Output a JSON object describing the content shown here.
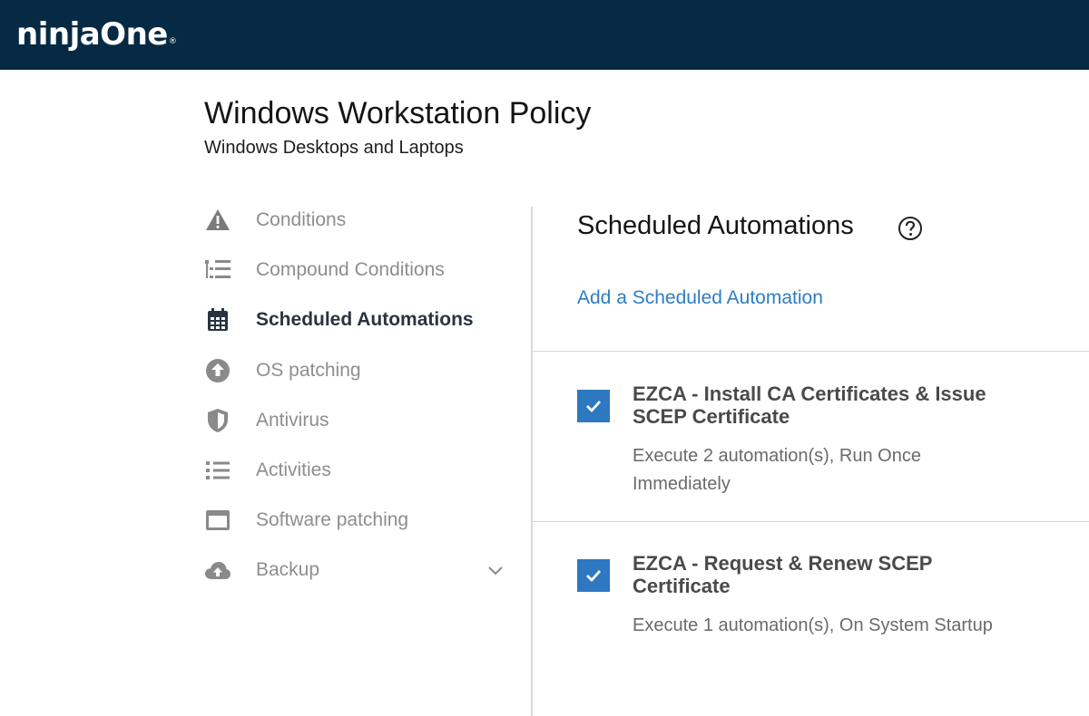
{
  "header": {
    "logo_text": "ninjaOne",
    "logo_mark": "®",
    "background": "#062a44"
  },
  "page": {
    "title": "Windows Workstation Policy",
    "subtitle": "Windows Desktops and Laptops"
  },
  "sidebar": {
    "items": [
      {
        "label": "Conditions",
        "icon": "warning-icon",
        "active": false
      },
      {
        "label": "Compound Conditions",
        "icon": "compound-list-icon",
        "active": false
      },
      {
        "label": "Scheduled Automations",
        "icon": "calendar-icon",
        "active": true
      },
      {
        "label": "OS patching",
        "icon": "upload-circle-icon",
        "active": false
      },
      {
        "label": "Antivirus",
        "icon": "shield-icon",
        "active": false
      },
      {
        "label": "Activities",
        "icon": "list-icon",
        "active": false
      },
      {
        "label": "Software patching",
        "icon": "window-icon",
        "active": false
      },
      {
        "label": "Backup",
        "icon": "cloud-upload-icon",
        "active": false,
        "expandable": true
      }
    ]
  },
  "main": {
    "title": "Scheduled Automations",
    "help_icon": "help-circle-icon",
    "add_link": "Add a Scheduled Automation",
    "accent_color": "#2d78c0",
    "automations": [
      {
        "name": "EZCA - Install CA Certificates & Issue SCEP Certificate",
        "description": "Execute 2 automation(s), Run Once Immediately",
        "checked": true
      },
      {
        "name": "EZCA - Request & Renew SCEP Certificate",
        "description": "Execute 1 automation(s), On System Startup",
        "checked": true
      }
    ]
  }
}
